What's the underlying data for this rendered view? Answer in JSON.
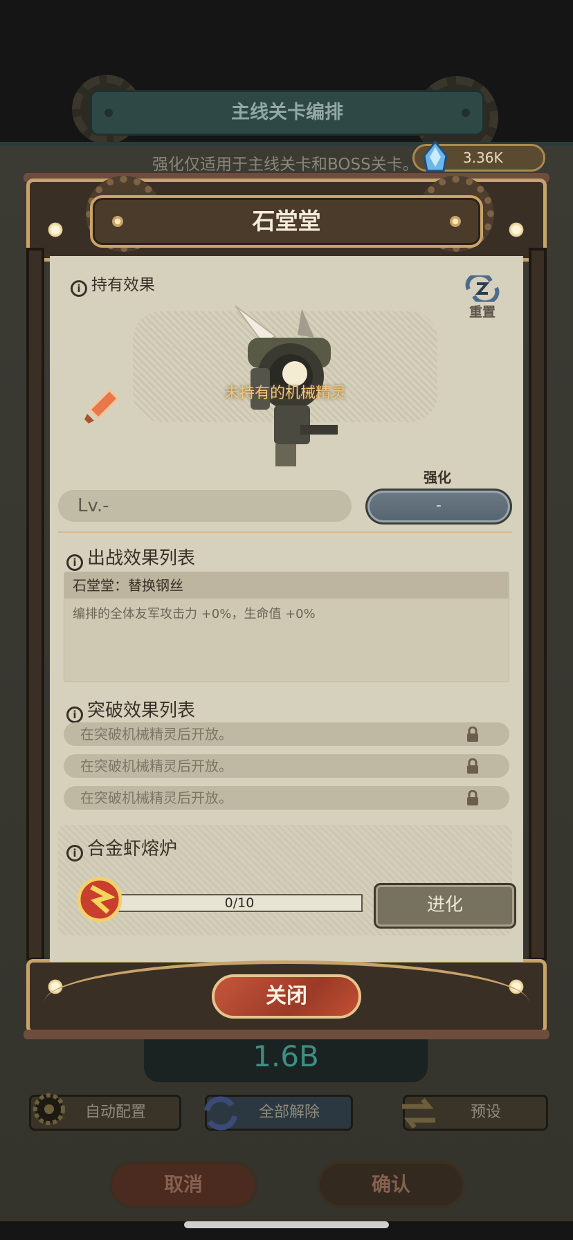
{
  "background": {
    "screen_title": "主线关卡编排",
    "hint": "强化仅适用于主线关卡和BOSS关卡。",
    "currency_value": "3.36K",
    "power_value": "1.6B",
    "buttons": {
      "auto_config": "自动配置",
      "unlink_all": "全部解除",
      "preset": "预设"
    },
    "cancel": "取消",
    "confirm": "确认"
  },
  "modal": {
    "title": "石堂堂",
    "owned_effect": "持有效果",
    "reset_label": "重置",
    "unowned_text": "未持有的机械精灵",
    "level_text": "Lv.-",
    "enhance_label": "强化",
    "enhance_value": "-",
    "battle_effects": {
      "title": "出战效果列表",
      "entry_title": "石堂堂：替换钢丝",
      "entry_desc": "编排的全体友军攻击力 +0%，生命值 +0%"
    },
    "breakthrough": {
      "title": "突破效果列表",
      "rows": [
        "在突破机械精灵后开放。",
        "在突破机械精灵后开放。",
        "在突破机械精灵后开放。"
      ]
    },
    "furnace": {
      "title": "合金虾熔炉",
      "progress_text": "0/10",
      "progress_fraction": 0,
      "evolve_label": "进化"
    },
    "close_label": "关闭"
  },
  "icons": [
    "info-icon",
    "reset-icon",
    "weapon-icon",
    "lock-icon",
    "furnace-icon",
    "gem-icon",
    "gear-icon",
    "unlink-icon",
    "swap-icon"
  ],
  "colors": {
    "panel": "#d6d1bd",
    "frame_gold": "#c7a469",
    "close_red": "#b8472f",
    "enhance_slate": "#5f6e78"
  }
}
